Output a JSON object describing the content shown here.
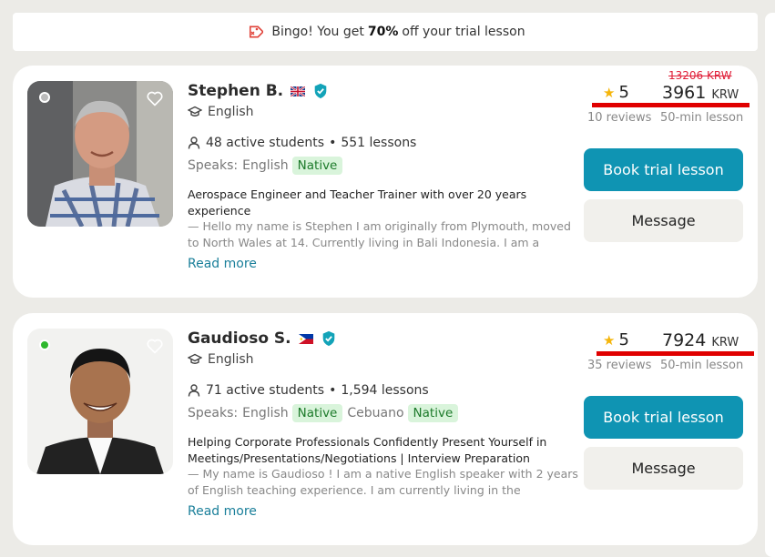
{
  "banner": {
    "text_before": "Bingo! You get",
    "highlight": "70%",
    "text_after": "off your trial lesson",
    "icon": "discount-tag-icon"
  },
  "tutors": [
    {
      "name": "Stephen B.",
      "flag": "uk-flag-icon",
      "subject": "English",
      "active_students": "48 active students",
      "separator": "•",
      "lessons": "551 lessons",
      "speaks_label": "Speaks:",
      "languages": [
        {
          "name": "English",
          "level": "Native"
        }
      ],
      "online": false,
      "headline": "Aerospace Engineer and Teacher Trainer with over 20 years experience",
      "description": "— Hello my name is Stephen I am originally from Plymouth, moved to North Wales at 14. Currently living in Bali Indonesia. I am a retired",
      "read_more": "Read more",
      "rating": "5",
      "reviews": "10 reviews",
      "old_price": "13206 KRW",
      "price": "3961",
      "currency": "KRW",
      "duration": "50-min lesson",
      "book_label": "Book trial lesson",
      "message_label": "Message"
    },
    {
      "name": "Gaudioso S.",
      "flag": "philippines-flag-icon",
      "subject": "English",
      "active_students": "71 active students",
      "separator": "•",
      "lessons": "1,594 lessons",
      "speaks_label": "Speaks:",
      "languages": [
        {
          "name": "English",
          "level": "Native"
        },
        {
          "name": "Cebuano",
          "level": "Native"
        }
      ],
      "online": true,
      "headline": "Helping Corporate Professionals Confidently Present Yourself in Meetings/Presentations/Negotiations | Interview Preparation",
      "description": "— My name is Gaudioso ! I am a native English speaker with 2 years of English teaching experience. I am currently living in the",
      "read_more": "Read more",
      "rating": "5",
      "reviews": "35 reviews",
      "price": "7924",
      "currency": "KRW",
      "duration": "50-min lesson",
      "book_label": "Book trial lesson",
      "message_label": "Message"
    }
  ],
  "colors": {
    "accent": "#0f94b3",
    "native_badge_bg": "#d9f4db",
    "native_badge_text": "#1c7a2a",
    "online": "#2eb82e",
    "markup_red": "#e00000"
  }
}
